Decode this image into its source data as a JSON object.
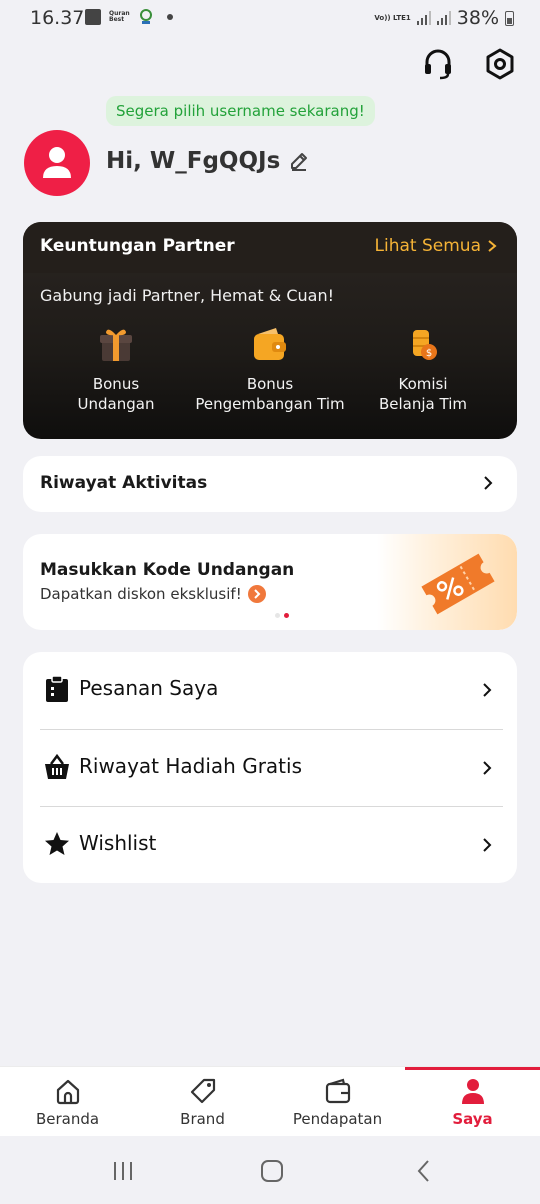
{
  "status_bar": {
    "time": "16.37",
    "quran_label": "Quran Best",
    "volte_label": "Vo)) LTE1",
    "battery": "38%"
  },
  "header": {
    "tip": "Segera pilih username sekarang!",
    "greeting": "Hi, W_FgQQJs"
  },
  "partner": {
    "title": "Keuntungan Partner",
    "see_all": "Lihat Semua",
    "subtitle": "Gabung jadi Partner, Hemat & Cuan!",
    "benefits": [
      {
        "line1": "Bonus",
        "line2": "Undangan",
        "icon": "gift-icon"
      },
      {
        "line1": "Bonus",
        "line2": "Pengembangan Tim",
        "icon": "wallet-icon"
      },
      {
        "line1": "Komisi",
        "line2": "Belanja Tim",
        "icon": "coin-stack-icon"
      }
    ]
  },
  "activity": {
    "label": "Riwayat Aktivitas"
  },
  "invite": {
    "title": "Masukkan Kode Undangan",
    "subtitle": "Dapatkan diskon eksklusif!",
    "carousel_active_index": 1,
    "carousel_count": 2
  },
  "menu": [
    {
      "label": "Pesanan Saya",
      "icon": "clipboard-icon"
    },
    {
      "label": "Riwayat Hadiah Gratis",
      "icon": "basket-icon"
    },
    {
      "label": "Wishlist",
      "icon": "star-icon"
    }
  ],
  "bottom_nav": [
    {
      "label": "Beranda",
      "icon": "home-icon",
      "active": false
    },
    {
      "label": "Brand",
      "icon": "tag-icon",
      "active": false
    },
    {
      "label": "Pendapatan",
      "icon": "wallet-icon",
      "active": false
    },
    {
      "label": "Saya",
      "icon": "person-icon",
      "active": true
    }
  ],
  "colors": {
    "accent": "#e21d3c",
    "avatar_bg": "#ef1f46",
    "partner_link": "#f5b336",
    "tip_text": "#23a23a",
    "tip_bg": "#ddf3dd"
  }
}
